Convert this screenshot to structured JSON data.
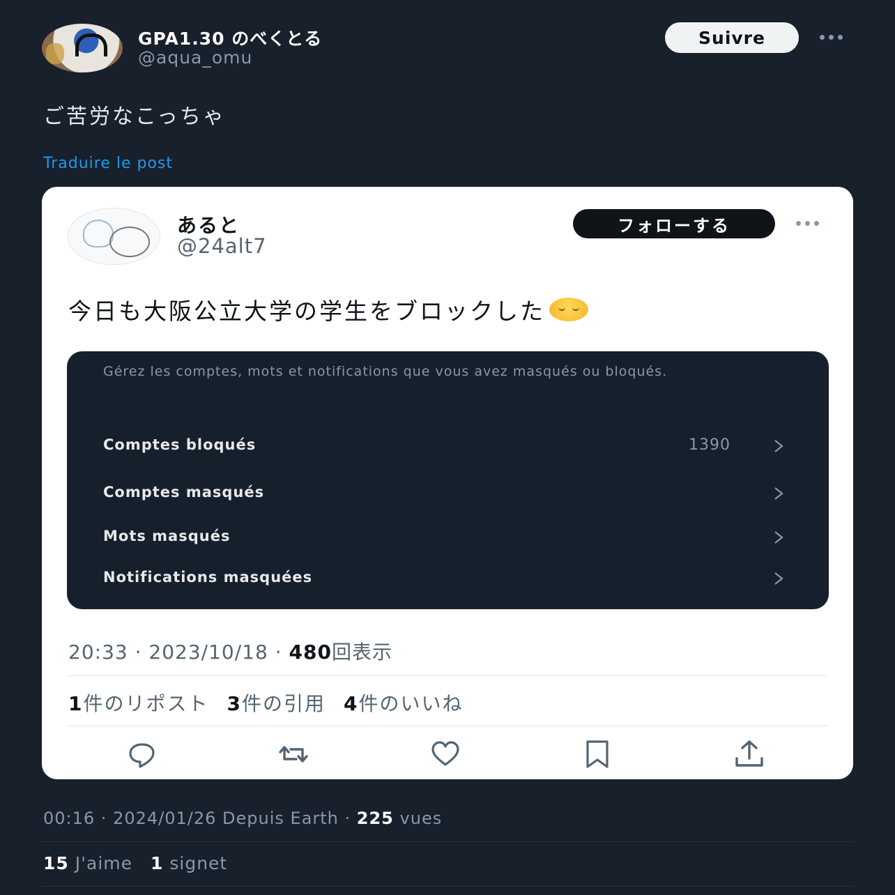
{
  "post": {
    "display_name": "GPA1.30 のべくとる",
    "handle": "@aqua_omu",
    "follow_label": "Suivre",
    "text": "ご苦労なこっちゃ",
    "translate_label": "Traduire le post"
  },
  "quoted": {
    "display_name": "あると",
    "handle": "@24alt7",
    "follow_label": "フォローする",
    "text": "今日も大阪公立大学の学生をブロックした",
    "emoji": "relieved-face",
    "panel": {
      "description": "Gérez les comptes, mots et notifications que vous avez masqués ou bloqués.",
      "rows": [
        {
          "label": "Comptes bloqués",
          "count": "1390"
        },
        {
          "label": "Comptes masqués",
          "count": ""
        },
        {
          "label": "Mots masqués",
          "count": ""
        },
        {
          "label": "Notifications masquées",
          "count": ""
        }
      ]
    },
    "meta": {
      "time": "20:33",
      "date": "2023/10/18",
      "views": "480",
      "views_label": "回表示"
    },
    "stats": [
      {
        "count": "1",
        "label": "件のリポスト"
      },
      {
        "count": "3",
        "label": "件の引用"
      },
      {
        "count": "4",
        "label": "件のいいね"
      }
    ]
  },
  "footer": {
    "time": "00:16",
    "date": "2024/01/26",
    "source": "Depuis Earth",
    "views": "225",
    "views_label": "vues",
    "stats": [
      {
        "count": "15",
        "label": "J'aime"
      },
      {
        "count": "1",
        "label": "signet"
      }
    ]
  },
  "colors": {
    "background": "#17202b",
    "link": "#1d9bf0",
    "card": "#ffffff",
    "panel": "#16202c"
  }
}
